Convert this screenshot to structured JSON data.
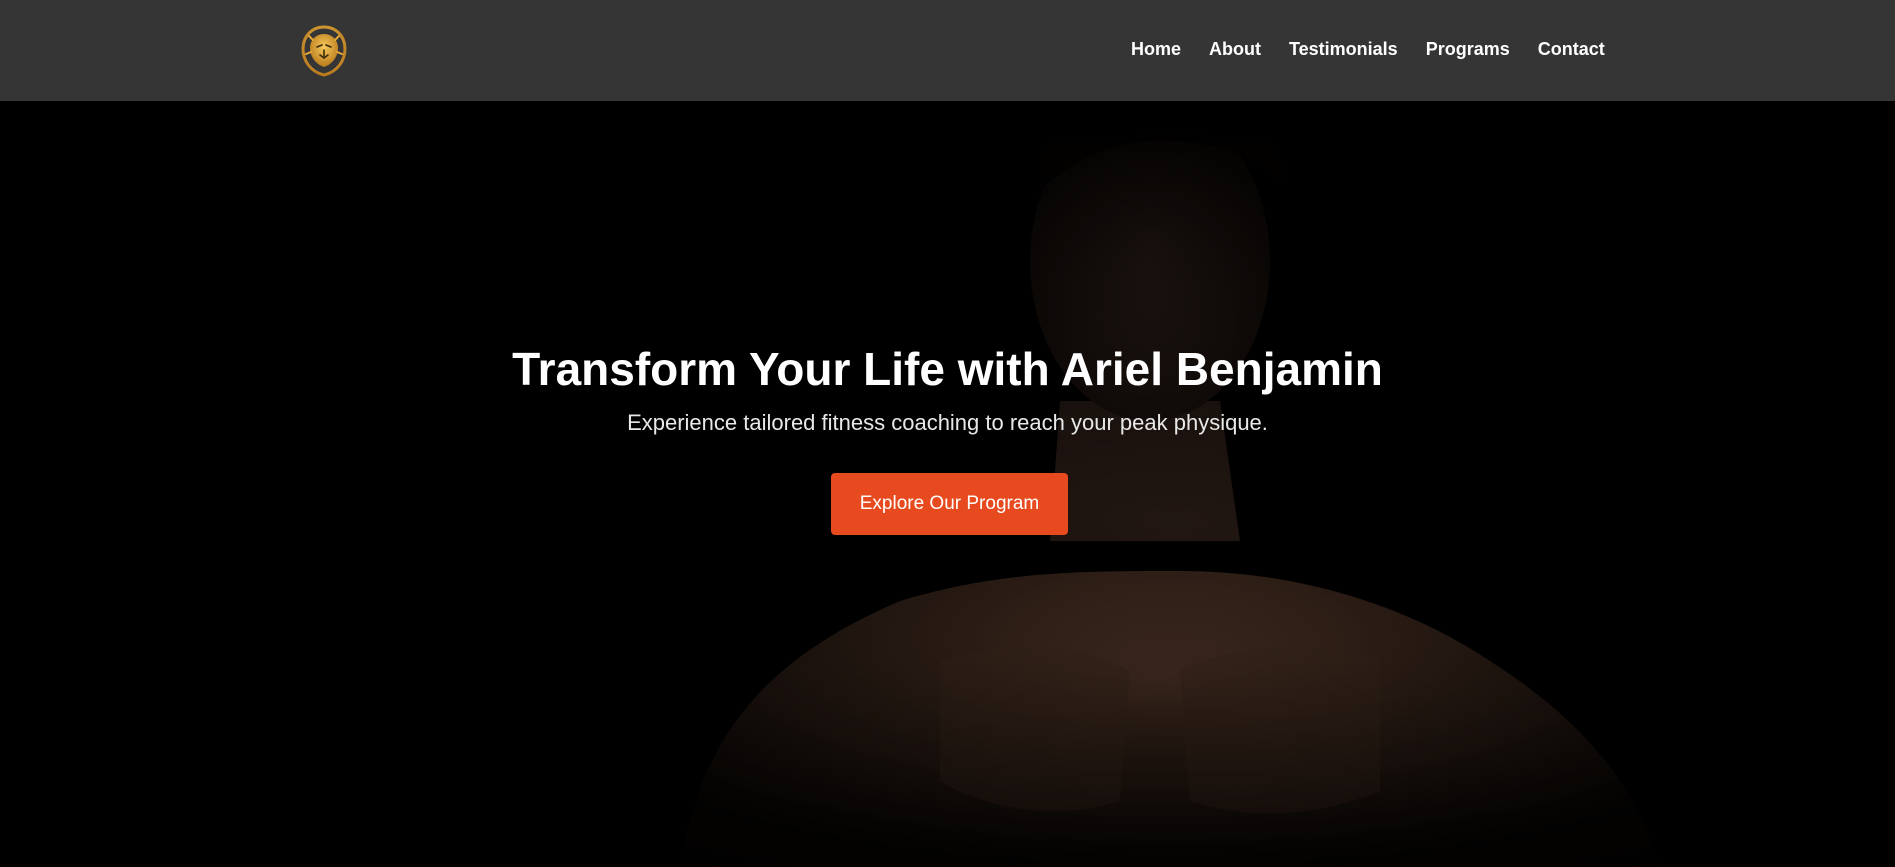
{
  "header": {
    "logo_icon": "lion-head-icon",
    "nav": [
      "Home",
      "About",
      "Testimonials",
      "Programs",
      "Contact"
    ]
  },
  "hero": {
    "headline": "Transform Your Life with Ariel Benjamin",
    "subheadline": "Experience tailored fitness coaching to reach your peak physique.",
    "cta_label": "Explore Our Program",
    "background_image": "dark portrait of a shirtless muscular man",
    "cta_color": "#e64a1e"
  },
  "colors": {
    "navbar_bg": "#353535",
    "hero_bg": "#000000",
    "logo_gold": "#e6a838"
  }
}
